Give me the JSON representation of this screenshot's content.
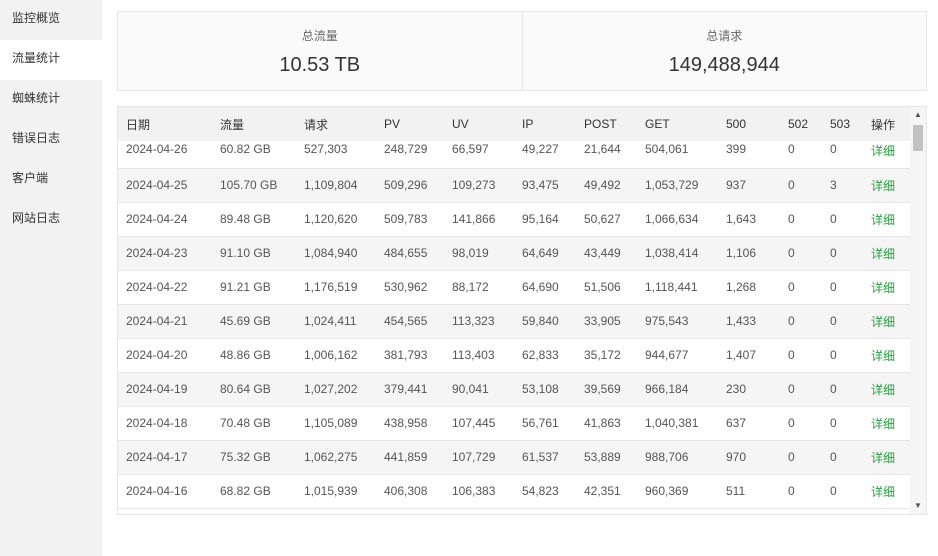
{
  "sidebar": {
    "items": [
      {
        "label": "监控概览",
        "active": false
      },
      {
        "label": "流量统计",
        "active": true
      },
      {
        "label": "蜘蛛统计",
        "active": false
      },
      {
        "label": "错误日志",
        "active": false
      },
      {
        "label": "客户端",
        "active": false
      },
      {
        "label": "网站日志",
        "active": false
      }
    ]
  },
  "summary": {
    "traffic_label": "总流量",
    "traffic_value": "10.53 TB",
    "requests_label": "总请求",
    "requests_value": "149,488,944"
  },
  "table": {
    "headers": [
      "日期",
      "流量",
      "请求",
      "PV",
      "UV",
      "IP",
      "POST",
      "GET",
      "500",
      "502",
      "503",
      "操作"
    ],
    "rows": [
      [
        "2024-04-26",
        "60.82 GB",
        "527,303",
        "248,729",
        "66,597",
        "49,227",
        "21,644",
        "504,061",
        "399",
        "0",
        "0",
        "详细"
      ],
      [
        "2024-04-25",
        "105.70 GB",
        "1,109,804",
        "509,296",
        "109,273",
        "93,475",
        "49,492",
        "1,053,729",
        "937",
        "0",
        "3",
        "详细"
      ],
      [
        "2024-04-24",
        "89.48 GB",
        "1,120,620",
        "509,783",
        "141,866",
        "95,164",
        "50,627",
        "1,066,634",
        "1,643",
        "0",
        "0",
        "详细"
      ],
      [
        "2024-04-23",
        "91.10 GB",
        "1,084,940",
        "484,655",
        "98,019",
        "64,649",
        "43,449",
        "1,038,414",
        "1,106",
        "0",
        "0",
        "详细"
      ],
      [
        "2024-04-22",
        "91.21 GB",
        "1,176,519",
        "530,962",
        "88,172",
        "64,690",
        "51,506",
        "1,118,441",
        "1,268",
        "0",
        "0",
        "详细"
      ],
      [
        "2024-04-21",
        "45.69 GB",
        "1,024,411",
        "454,565",
        "113,323",
        "59,840",
        "33,905",
        "975,543",
        "1,433",
        "0",
        "0",
        "详细"
      ],
      [
        "2024-04-20",
        "48.86 GB",
        "1,006,162",
        "381,793",
        "113,403",
        "62,833",
        "35,172",
        "944,677",
        "1,407",
        "0",
        "0",
        "详细"
      ],
      [
        "2024-04-19",
        "80.64 GB",
        "1,027,202",
        "379,441",
        "90,041",
        "53,108",
        "39,569",
        "966,184",
        "230",
        "0",
        "0",
        "详细"
      ],
      [
        "2024-04-18",
        "70.48 GB",
        "1,105,089",
        "438,958",
        "107,445",
        "56,761",
        "41,863",
        "1,040,381",
        "637",
        "0",
        "0",
        "详细"
      ],
      [
        "2024-04-17",
        "75.32 GB",
        "1,062,275",
        "441,859",
        "107,729",
        "61,537",
        "53,889",
        "988,706",
        "970",
        "0",
        "0",
        "详细"
      ],
      [
        "2024-04-16",
        "68.82 GB",
        "1,015,939",
        "406,308",
        "106,383",
        "54,823",
        "42,351",
        "960,369",
        "511",
        "0",
        "0",
        "详细"
      ]
    ]
  },
  "scrollbar": {
    "up_glyph": "▲",
    "down_glyph": "▼"
  }
}
